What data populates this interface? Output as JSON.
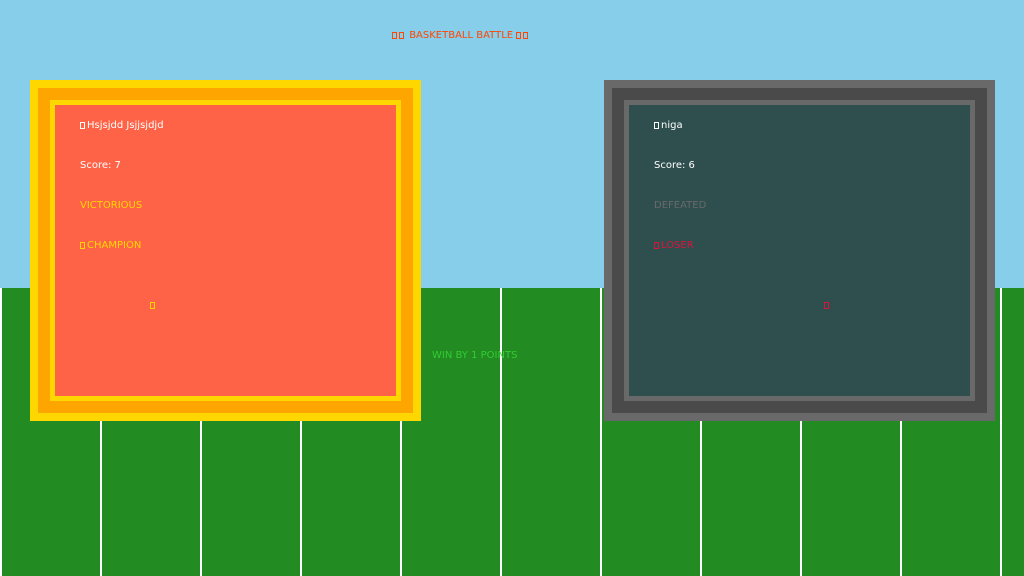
{
  "game": {
    "title": "BASKETBALL BATTLE",
    "title_icon": "trophy-icon",
    "margin_text": "WIN BY 1 POINTS"
  },
  "winner": {
    "name": "Hsjsjdd Jsjjsjdjd",
    "score": "Score: 7",
    "status": "VICTORIOUS",
    "rank": "CHAMPION",
    "name_icon": "crown-icon",
    "rank_icon": "trophy-icon",
    "badge_icon": "star-icon",
    "colors": {
      "frame": "#ffd700",
      "trim": "#ffa500",
      "card": "#ff6347",
      "accent": "#ffd700"
    }
  },
  "loser": {
    "name": "niga",
    "score": "Score: 6",
    "status": "DEFEATED",
    "rank": "LOSER",
    "name_icon": "sad-face-icon",
    "rank_icon": "broken-heart-icon",
    "badge_icon": "sad-icon",
    "colors": {
      "frame": "#696969",
      "trim": "#4a4a4a",
      "card": "#2f4f4f",
      "accent": "#dc143c"
    }
  },
  "scene": {
    "sky_color": "#87ceeb",
    "field_color": "#228b22",
    "line_color": "#ffffff"
  }
}
